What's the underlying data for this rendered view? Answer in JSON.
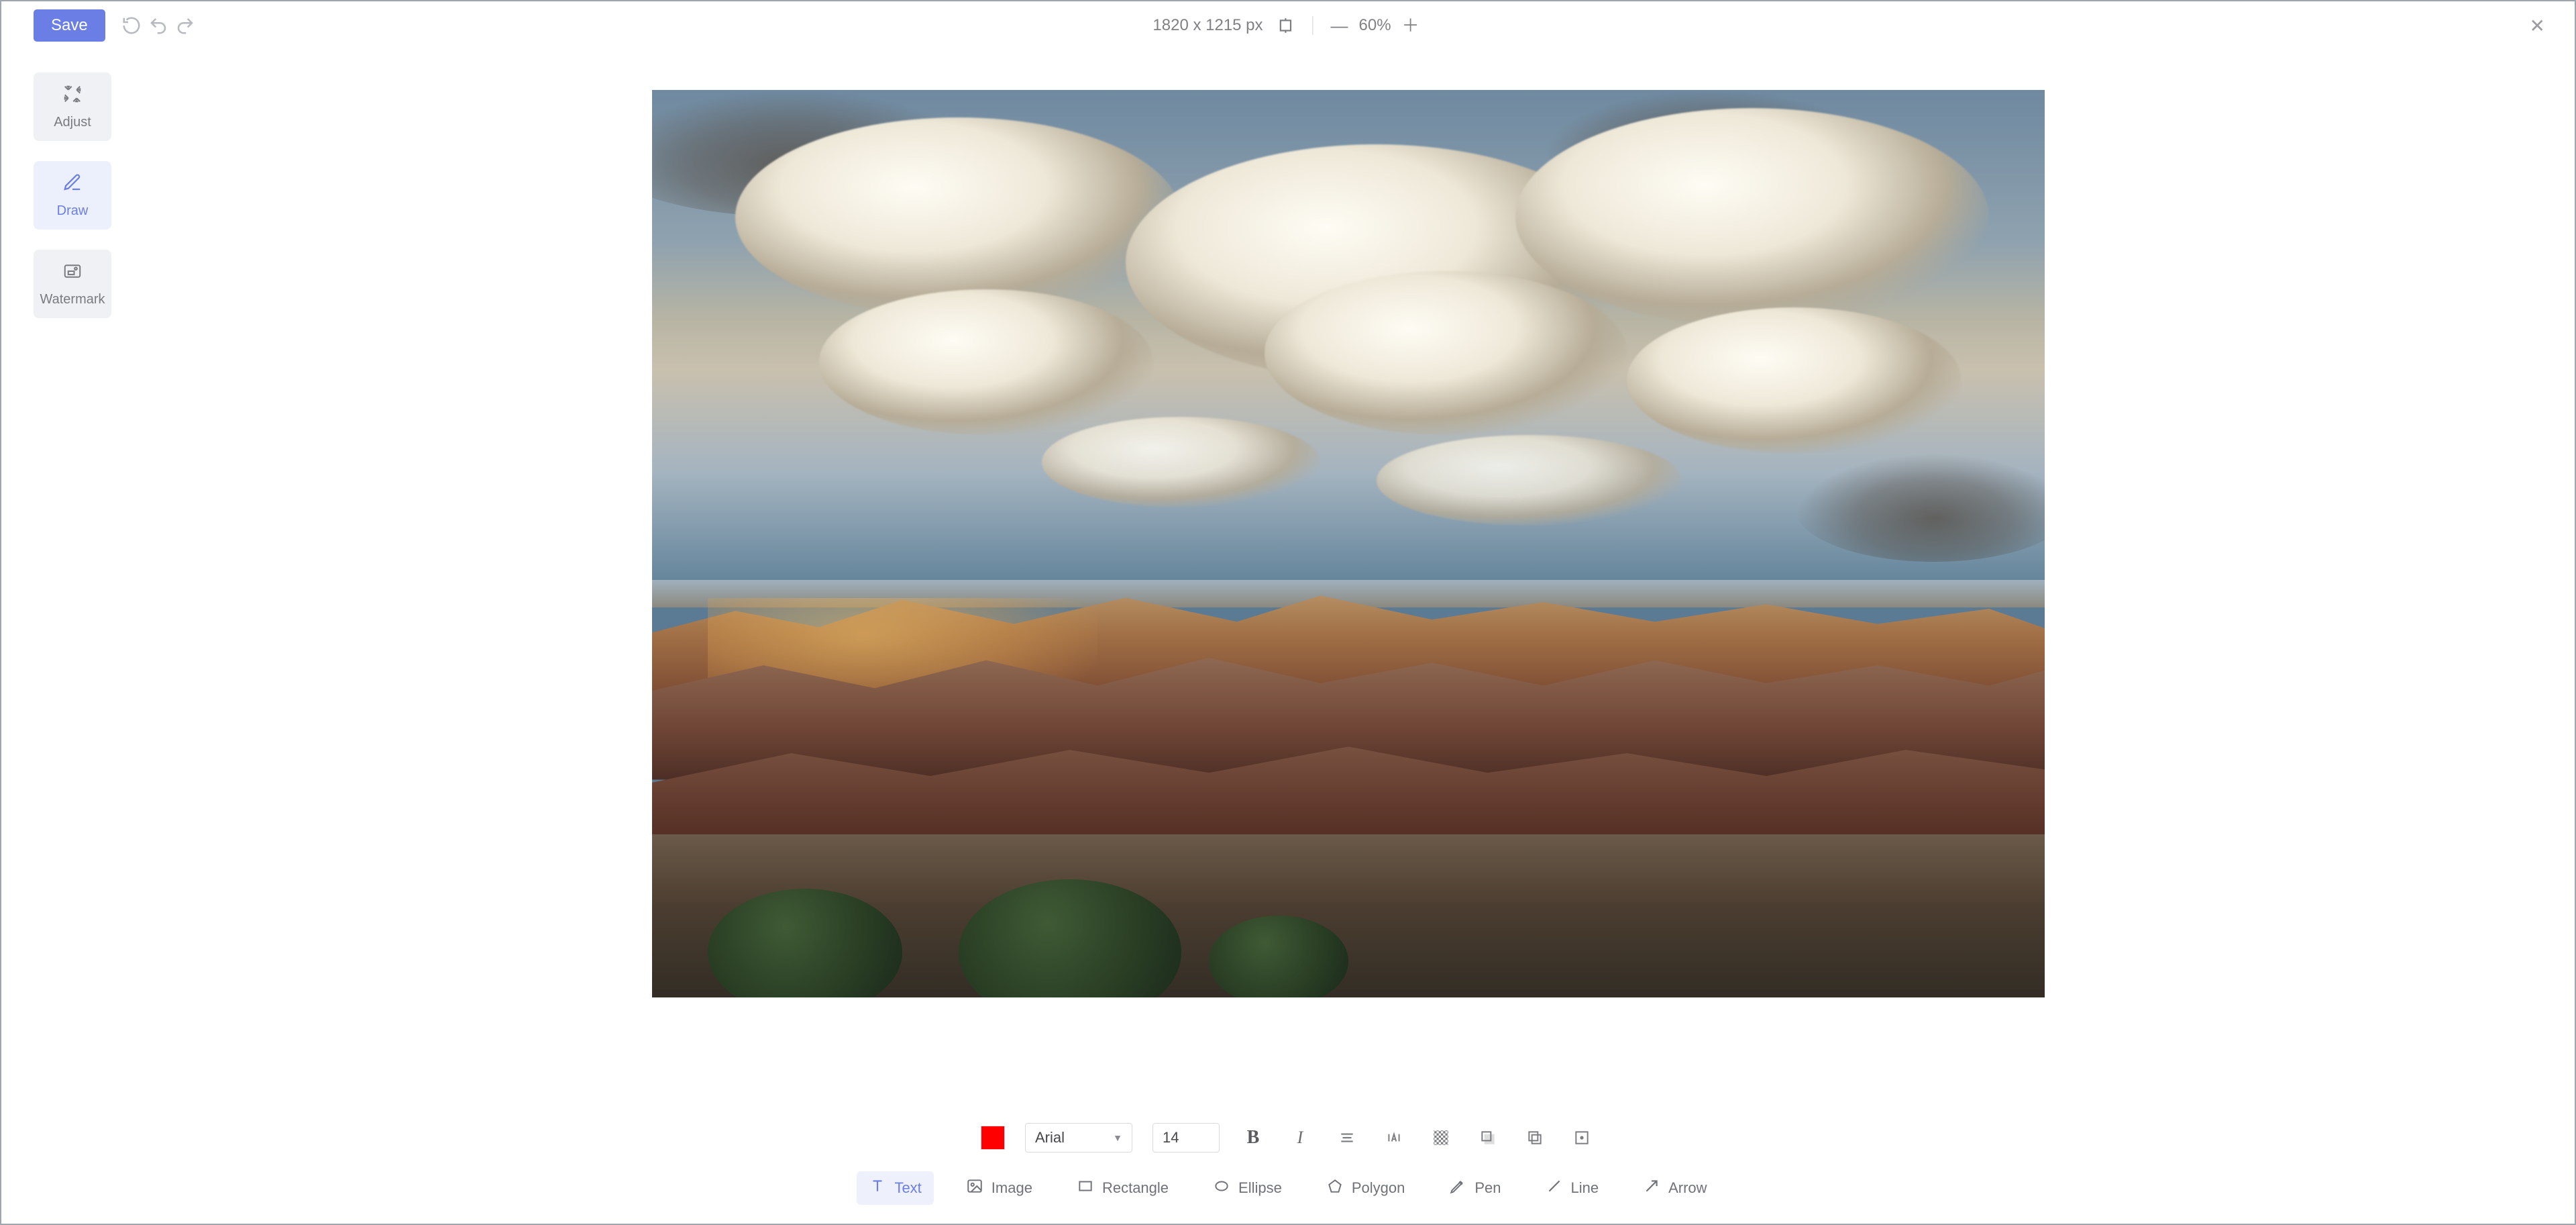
{
  "topbar": {
    "save_label": "Save",
    "dimensions": "1820 x 1215 px",
    "zoom": "60%"
  },
  "sidebar": {
    "adjust_label": "Adjust",
    "draw_label": "Draw",
    "watermark_label": "Watermark"
  },
  "text_options": {
    "color": "#ff0000",
    "font": "Arial",
    "size": "14"
  },
  "tools": {
    "text": "Text",
    "image": "Image",
    "rectangle": "Rectangle",
    "ellipse": "Ellipse",
    "polygon": "Polygon",
    "pen": "Pen",
    "line": "Line",
    "arrow": "Arrow"
  }
}
